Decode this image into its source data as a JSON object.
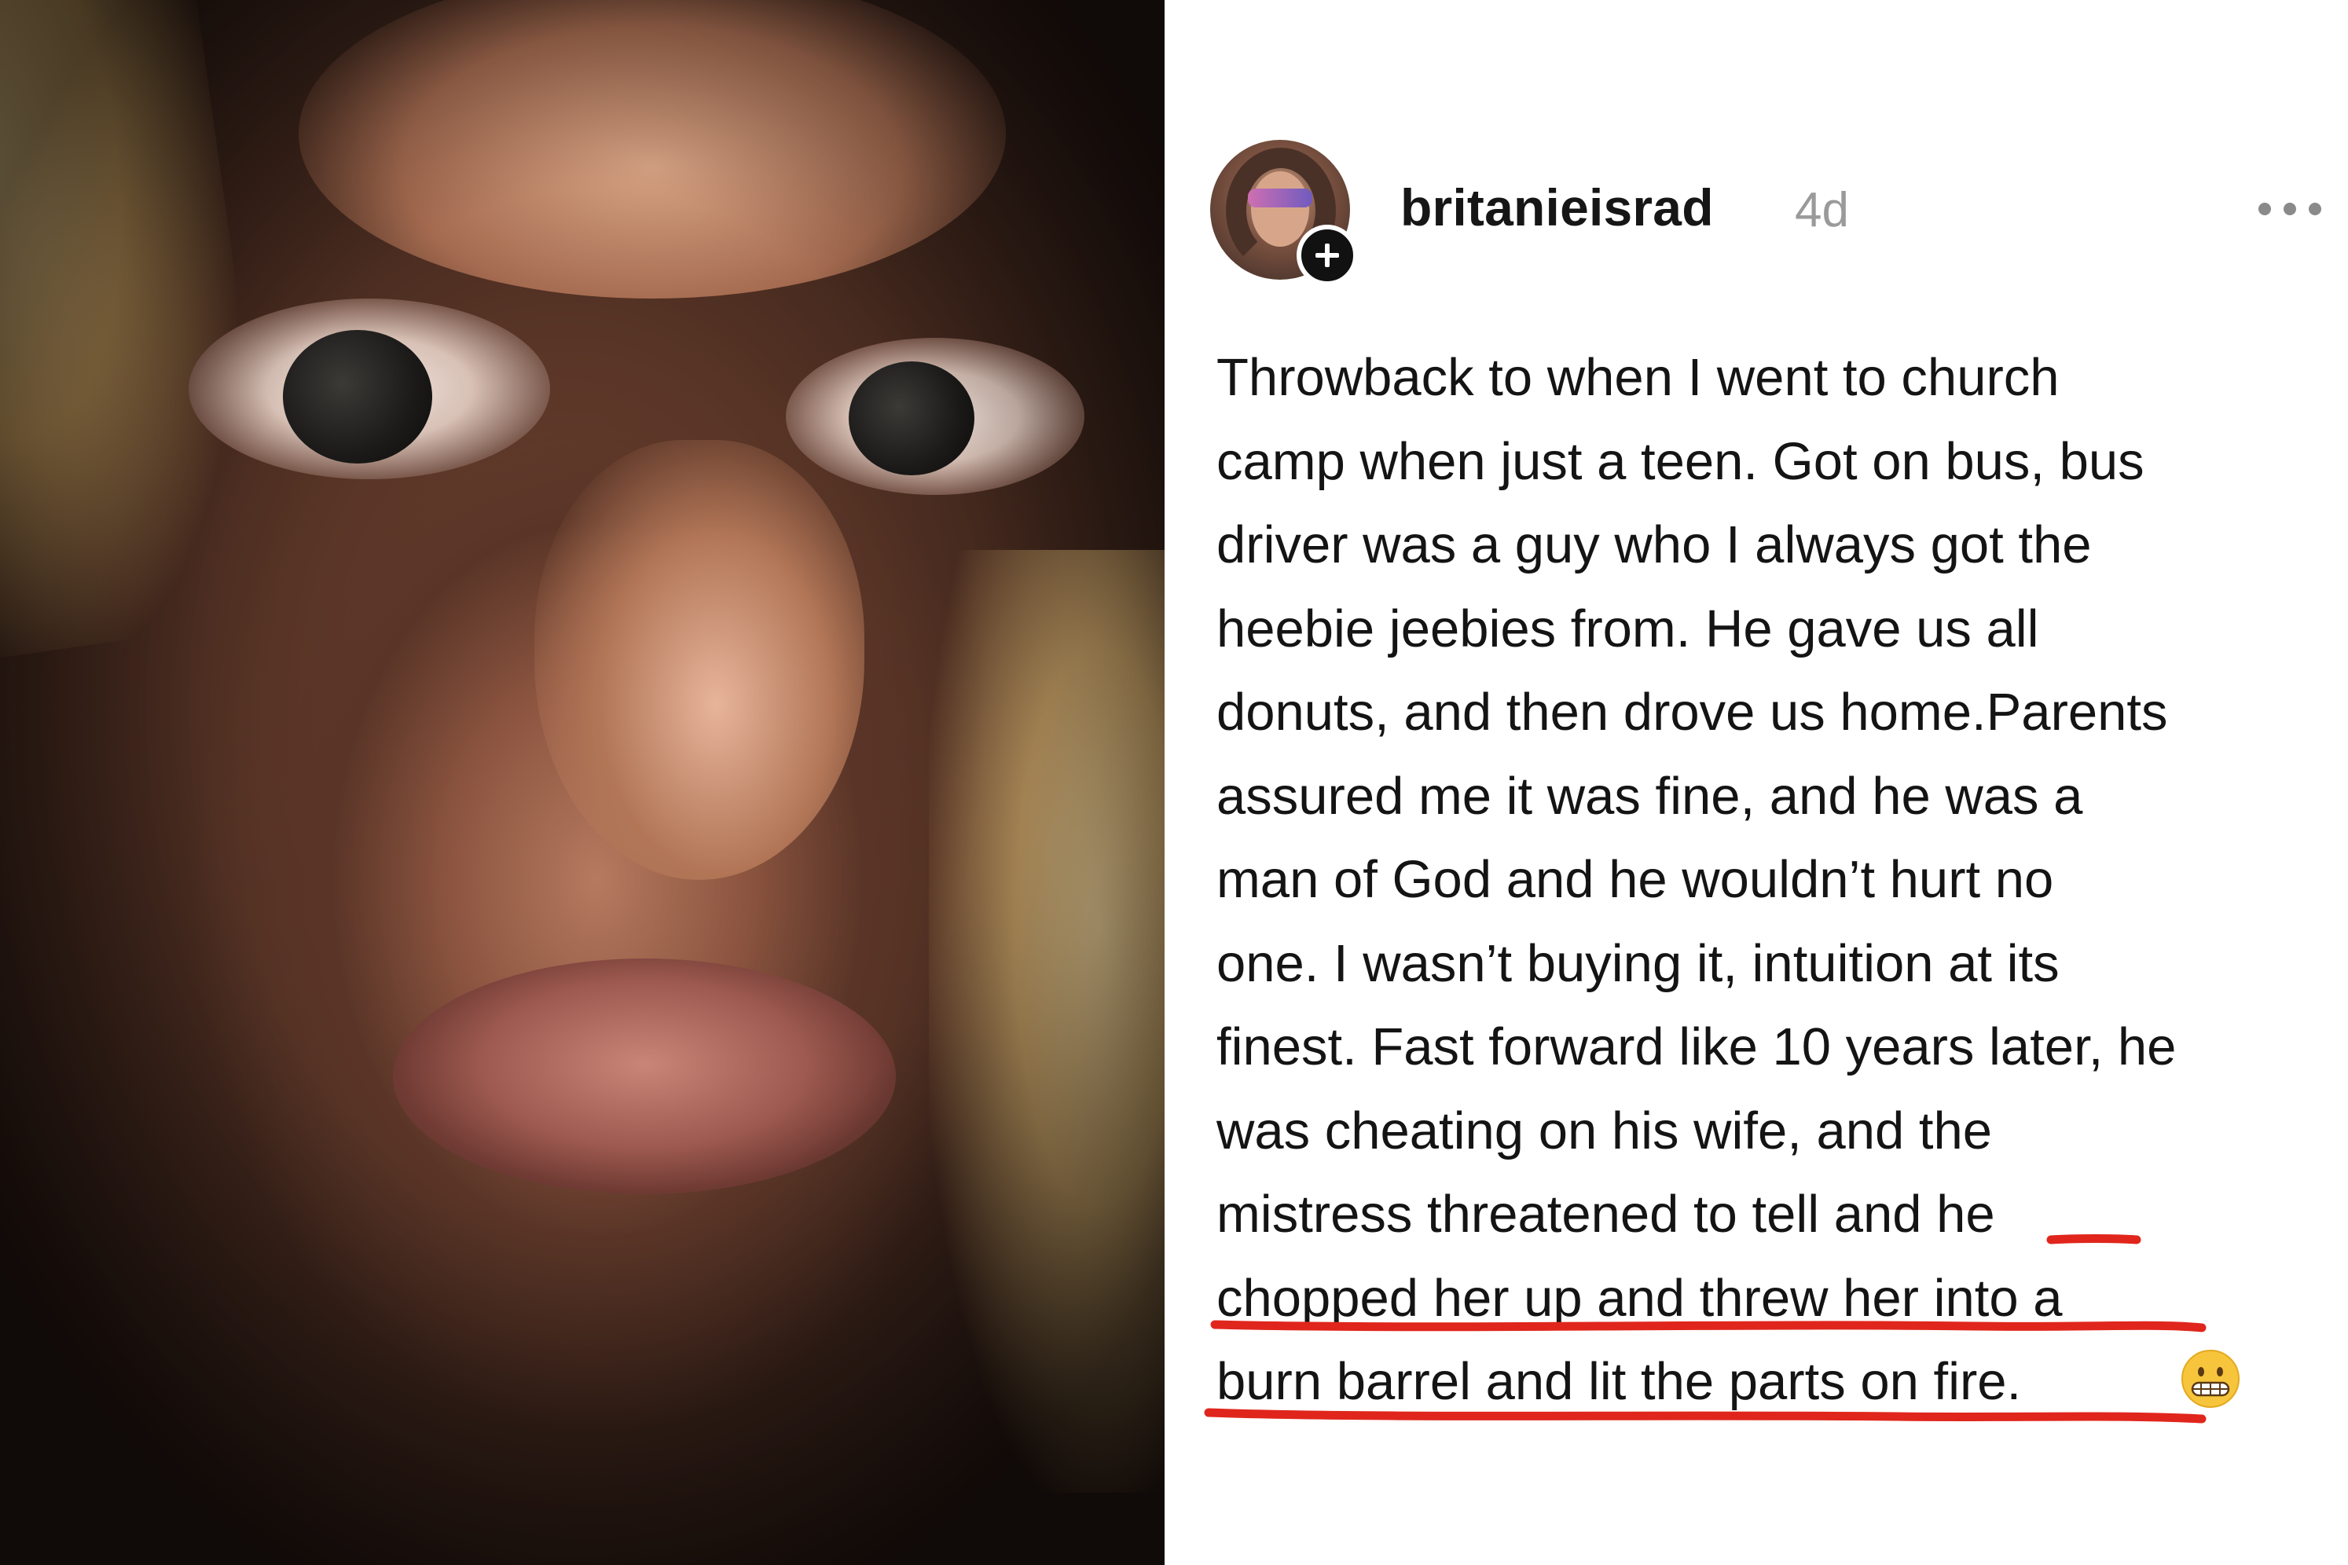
{
  "post": {
    "username": "britanieisrad",
    "timestamp": "4d",
    "lines": [
      "Throwback to when I went to church",
      "camp when just a teen. Got on bus, bus",
      "driver was a guy who I always got the",
      "heebie jeebies from. He gave us all",
      "donuts, and then drove us home.Parents",
      "assured me it was fine, and he was a",
      "man of God and he wouldn’t hurt no",
      "one. I wasn’t buying it, intuition at its",
      "finest. Fast forward like 10 years later, he",
      "was cheating on his wife, and the",
      "mistress threatened to tell and he",
      "chopped her up and threw her into a",
      "burn barrel and lit the parts on fire."
    ],
    "emoji": "grimacing-face",
    "underline_color": "#e0261c",
    "text_color": "#141414",
    "timestamp_color": "#9a9a9a"
  },
  "icons": {
    "follow": "plus-icon",
    "menu": "more-horizontal-icon"
  }
}
